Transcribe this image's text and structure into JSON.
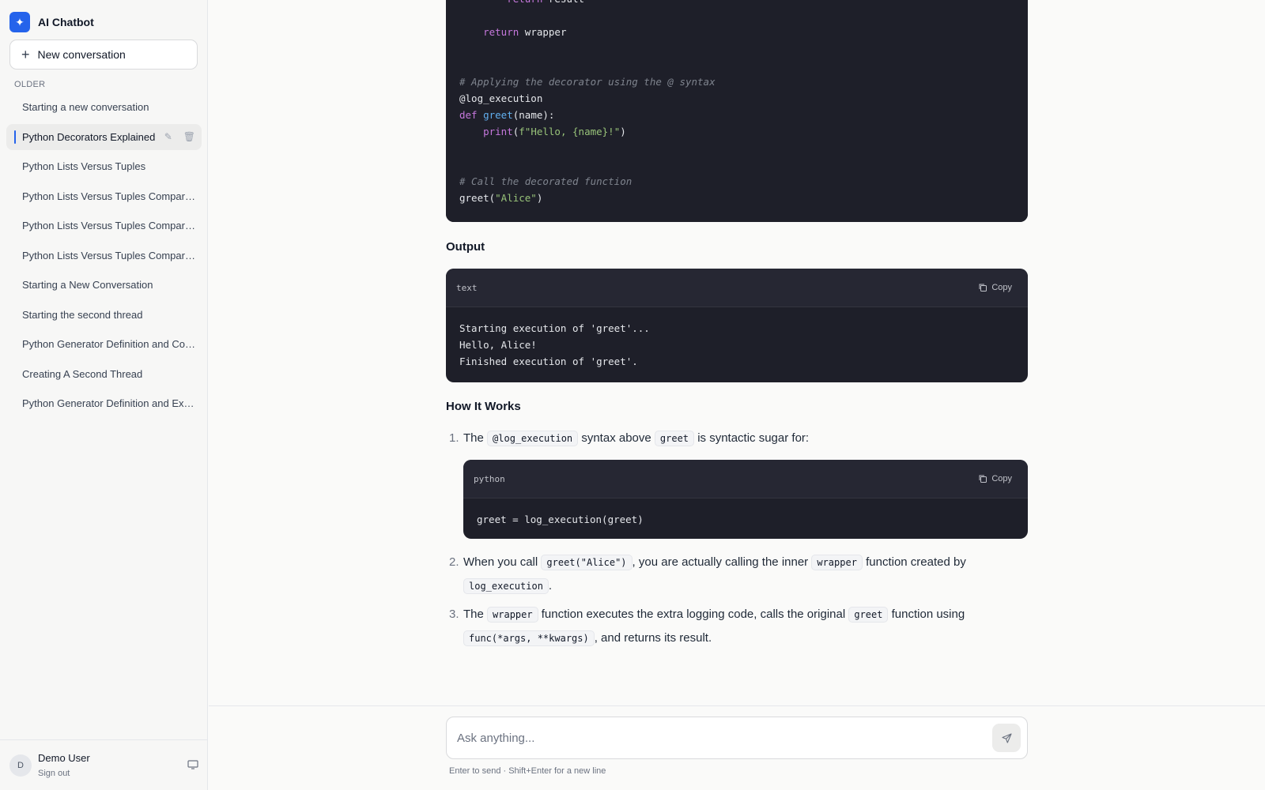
{
  "app": {
    "title": "AI Chatbot",
    "logo_icon": "sparkle-icon"
  },
  "sidebar": {
    "new_conversation_label": "New conversation",
    "section_label": "OLDER",
    "conversations": [
      {
        "label": "Starting a new conversation"
      },
      {
        "label": "Python Decorators Explained",
        "active": true
      },
      {
        "label": "Python Lists Versus Tuples"
      },
      {
        "label": "Python Lists Versus Tuples Comparison"
      },
      {
        "label": "Python Lists Versus Tuples Comparison"
      },
      {
        "label": "Python Lists Versus Tuples Comparison"
      },
      {
        "label": "Starting a New Conversation"
      },
      {
        "label": "Starting the second thread"
      },
      {
        "label": "Python Generator Definition and Comparison"
      },
      {
        "label": "Creating A Second Thread"
      },
      {
        "label": "Python Generator Definition and Example"
      }
    ],
    "user": {
      "initial": "D",
      "name": "Demo User",
      "sign_out": "Sign out"
    }
  },
  "message": {
    "code_block_1": {
      "lines": [
        "        return result",
        "",
        "    return wrapper",
        "",
        "",
        "# Applying the decorator using the @ syntax",
        "@log_execution",
        "def greet(name):",
        "    print(f\"Hello, {name}!\")",
        "",
        "",
        "# Call the decorated function",
        "greet(\"Alice\")"
      ]
    },
    "output_heading": "Output",
    "output_block": {
      "lang": "text",
      "copy_label": "Copy",
      "lines": [
        "Starting execution of 'greet'...",
        "Hello, Alice!",
        "Finished execution of 'greet'."
      ]
    },
    "how_heading": "How It Works",
    "steps": {
      "s1": {
        "num": "1.",
        "t1": "The ",
        "c1": "@log_execution",
        "t2": " syntax above ",
        "c2": "greet",
        "t3": " is syntactic sugar for:"
      },
      "python_block": {
        "lang": "python",
        "copy_label": "Copy",
        "code": "greet = log_execution(greet)"
      },
      "s2": {
        "num": "2.",
        "t1": "When you call ",
        "c1": "greet(\"Alice\")",
        "t2": ", you are actually calling the inner ",
        "c2": "wrapper",
        "t3": " function created by ",
        "c3": "log_execution",
        "t4": "."
      },
      "s3": {
        "num": "3.",
        "t1": "The ",
        "c1": "wrapper",
        "t2": " function executes the extra logging code, calls the original ",
        "c2": "greet",
        "t3": " function using ",
        "c3": "func(*args, **kwargs)",
        "t4": ", and returns its result."
      }
    }
  },
  "composer": {
    "placeholder": "Ask anything...",
    "hint": "Enter to send · Shift+Enter for a new line"
  }
}
